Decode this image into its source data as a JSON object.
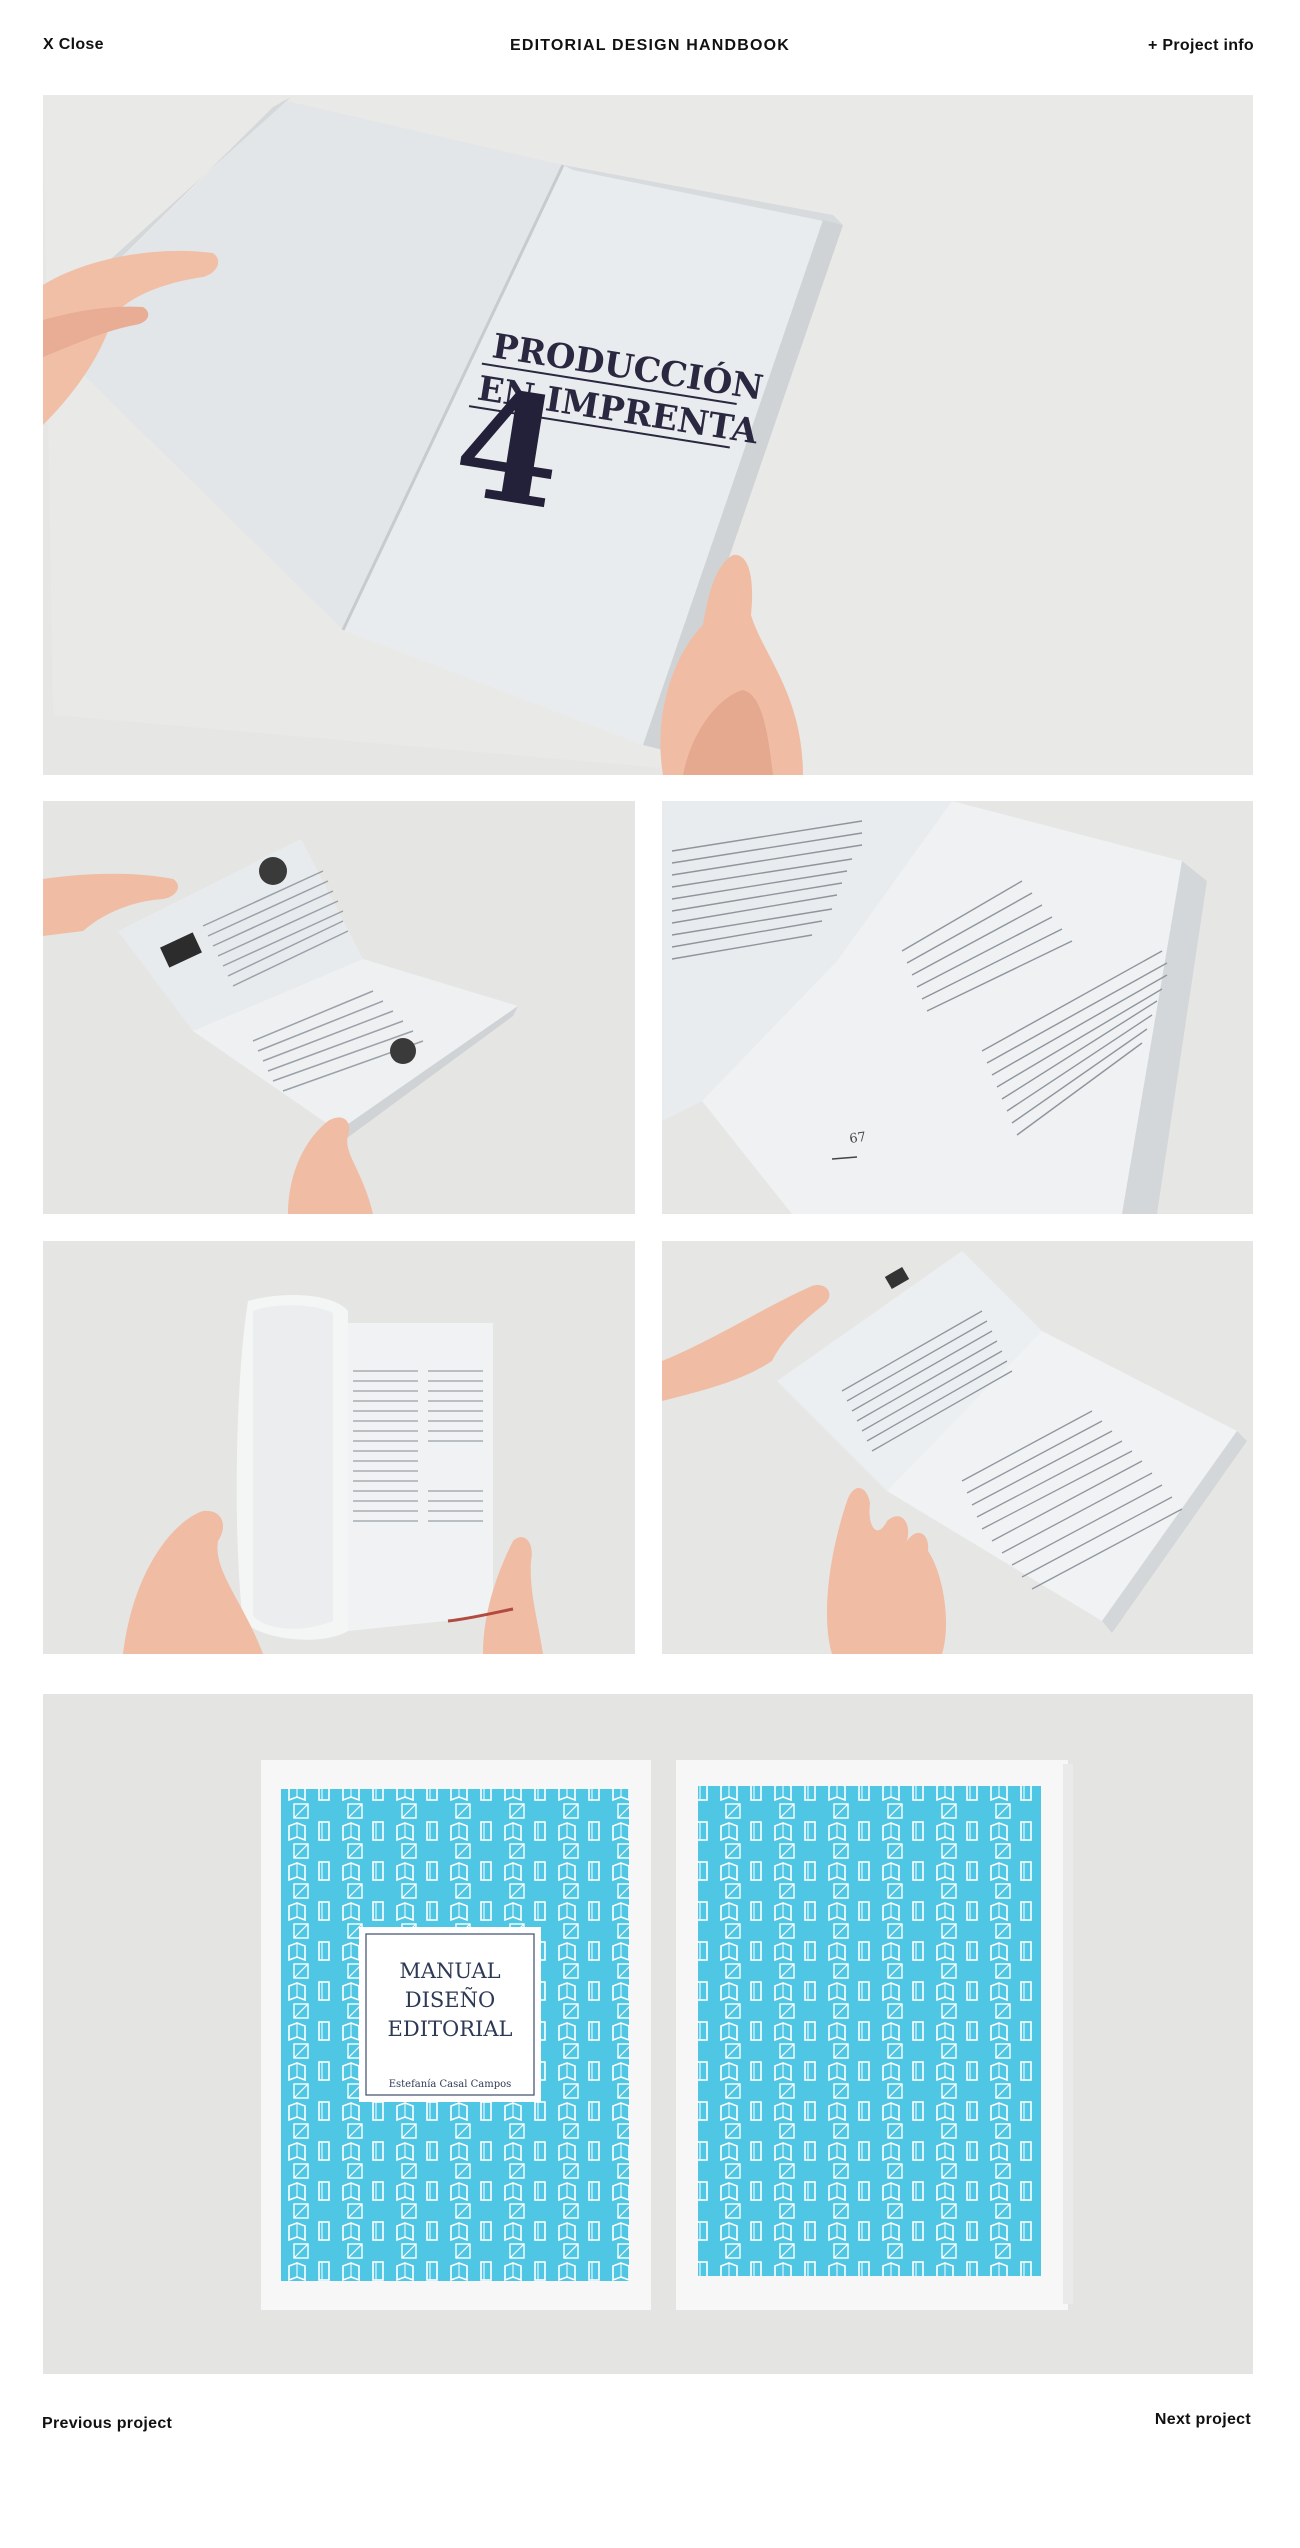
{
  "header": {
    "close_label": "X Close",
    "title": "EDITORIAL DESIGN HANDBOOK",
    "info_label": "+ Project info"
  },
  "gallery": {
    "hero_chapter_line1": "PRODUCCIÓN",
    "hero_chapter_line2": "EN IMPRENTA",
    "hero_chapter_number": "4",
    "page_number": "67",
    "cover_title_line1": "MANUAL",
    "cover_title_line2": "DISEÑO",
    "cover_title_line3": "EDITORIAL",
    "cover_author": "Estefanía Casal Campos",
    "cover_color": "#4fc6e3"
  },
  "footer": {
    "prev_label": "Previous project",
    "next_label": "Next project"
  }
}
